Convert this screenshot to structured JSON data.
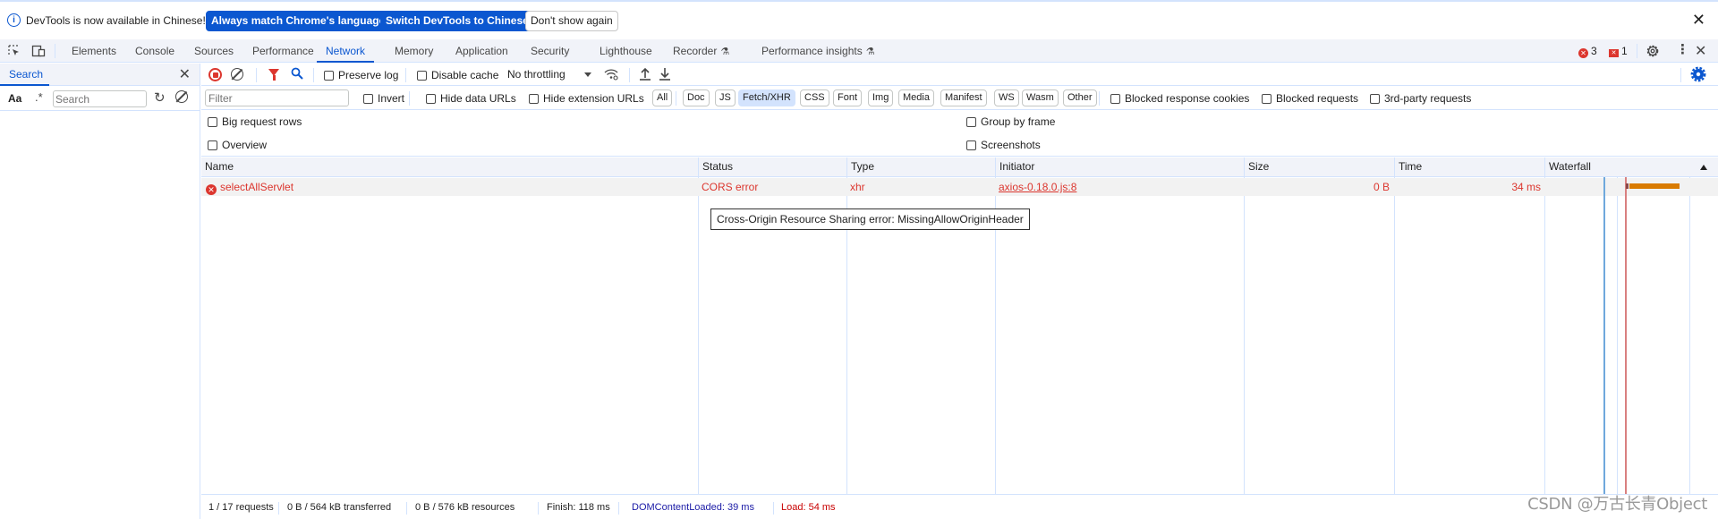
{
  "infobar": {
    "message": "DevTools is now available in Chinese!",
    "buttons": [
      "Always match Chrome's language",
      "Switch DevTools to Chinese",
      "Don't show again"
    ]
  },
  "tabs": [
    {
      "label": "Elements"
    },
    {
      "label": "Console"
    },
    {
      "label": "Sources"
    },
    {
      "label": "Performance"
    },
    {
      "label": "Network",
      "active": true
    },
    {
      "label": "Memory"
    },
    {
      "label": "Application"
    },
    {
      "label": "Security"
    },
    {
      "label": "Lighthouse"
    },
    {
      "label": "Recorder",
      "experimental": true
    },
    {
      "label": "Performance insights",
      "experimental": true
    }
  ],
  "issues": {
    "errors": "3",
    "warnings": "1"
  },
  "search_pane": {
    "tab_label": "Search",
    "match_case_label": "Aa",
    "regex_label": ".*",
    "input_placeholder": "Search",
    "input_value": ""
  },
  "network": {
    "toolbar": {
      "preserve_log": "Preserve log",
      "disable_cache": "Disable cache",
      "throttling": "No throttling"
    },
    "filter": {
      "placeholder": "Filter",
      "invert": "Invert",
      "hide_data_urls": "Hide data URLs",
      "hide_extension_urls": "Hide extension URLs",
      "types": [
        "All",
        "Doc",
        "JS",
        "Fetch/XHR",
        "CSS",
        "Font",
        "Img",
        "Media",
        "Manifest",
        "WS",
        "Wasm",
        "Other"
      ],
      "active_type": "Fetch/XHR",
      "blocked_response_cookies": "Blocked response cookies",
      "blocked_requests": "Blocked requests",
      "third_party_requests": "3rd-party requests"
    },
    "settings": {
      "big_request_rows": "Big request rows",
      "overview": "Overview",
      "group_by_frame": "Group by frame",
      "screenshots": "Screenshots"
    },
    "columns": [
      "Name",
      "Status",
      "Type",
      "Initiator",
      "Size",
      "Time",
      "Waterfall"
    ],
    "rows": [
      {
        "name": "selectAllServlet",
        "status": "CORS error",
        "type": "xhr",
        "initiator": "axios-0.18.0.js:8",
        "size": "0 B",
        "time": "34 ms"
      }
    ],
    "tooltip": "Cross-Origin Resource Sharing error: MissingAllowOriginHeader",
    "status_bar": {
      "requests": "1 / 17 requests",
      "transferred": "0 B / 564 kB transferred",
      "resources": "0 B / 576 kB resources",
      "finish": "Finish: 118 ms",
      "dom_content_loaded": "DOMContentLoaded: 39 ms",
      "load": "Load: 54 ms"
    },
    "colors": {
      "error": "#dc362e",
      "dom_content_loaded": "#1a1aa6",
      "load": "#c80000",
      "accent": "#0b57d0",
      "waterfall_bar": "#d97b00"
    }
  },
  "watermark": "CSDN @万古长青Object"
}
